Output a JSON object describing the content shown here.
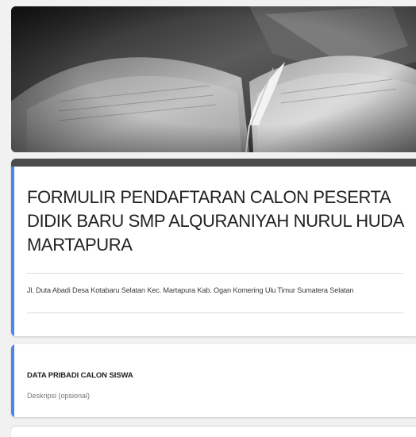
{
  "header": {
    "image_icon": "book-quill-photo"
  },
  "form": {
    "title": "FORMULIR PENDAFTARAN CALON PESERTA DIDIK BARU SMP ALQURANIYAH NURUL HUDA MARTAPURA",
    "description": "Jl. Duta Abadi Desa Kotabaru Selatan Kec. Martapura Kab. Ogan Komering Ulu Timur Sumatera Selatan"
  },
  "section": {
    "title": "DATA PRIBADI CALON SISWA",
    "description": "Deskripsi (opsional)"
  },
  "colors": {
    "accent": "#4f86ec",
    "title_bar": "#4c4c4c",
    "background": "#f1f1f1"
  }
}
